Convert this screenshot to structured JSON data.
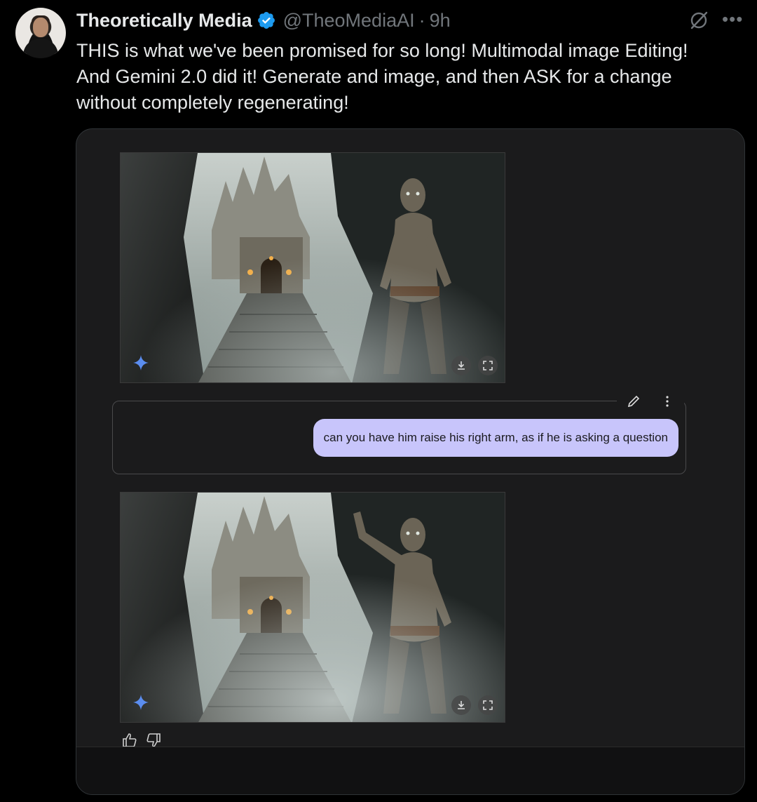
{
  "author": {
    "display_name": "Theoretically Media",
    "handle": "@TheoMediaAI",
    "separator": "·",
    "time": "9h",
    "verified_color": "#1d9bf0"
  },
  "tweet": {
    "text": "THIS is what we've been promised for so long! Multimodal image Editing!\nAnd Gemini 2.0 did it! Generate and image, and then ASK for a change\nwithout completely regenerating!"
  },
  "chat": {
    "user_prompt": "can you have him raise his right arm, as if he is asking a question",
    "bubble_color": "#c8c5fb",
    "sparkle_color": "#5b8def"
  },
  "icons": {
    "grok": "grok-icon",
    "more": "more-options-icon",
    "download": "download-icon",
    "fullscreen": "fullscreen-icon",
    "edit": "pencil-edit-icon",
    "kebab": "vertical-dots-icon",
    "thumbs_up": "thumbs-up-icon",
    "thumbs_down": "thumbs-down-icon",
    "sparkle": "gemini-sparkle-icon"
  }
}
